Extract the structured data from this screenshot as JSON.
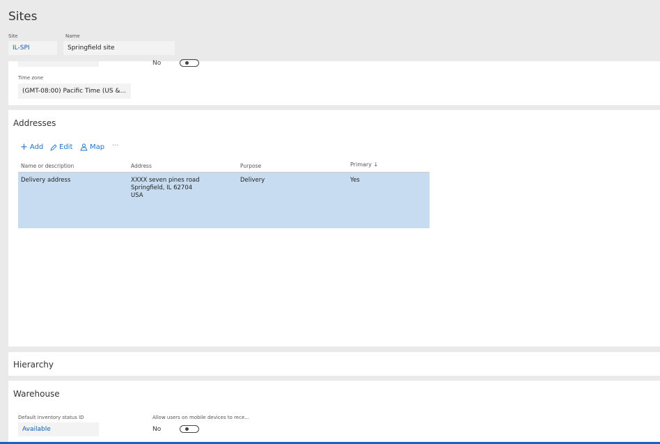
{
  "page": {
    "title": "Sites"
  },
  "header": {
    "site_label": "Site",
    "site_value": "IL-SPI",
    "name_label": "Name",
    "name_value": "Springfield site"
  },
  "general": {
    "partial_value": "No",
    "timezone_label": "Time zone",
    "timezone_value": "(GMT-08:00) Pacific Time (US &..."
  },
  "addresses": {
    "title": "Addresses",
    "toolbar": {
      "add": "Add",
      "edit": "Edit",
      "map": "Map",
      "more": "···"
    },
    "columns": [
      "Name or description",
      "Address",
      "Purpose",
      "Primary ↓"
    ],
    "rows": [
      {
        "name": "Delivery address",
        "address_line1": "XXXX seven pines road",
        "address_line2": "Springfield, IL 62704",
        "address_line3": "USA",
        "purpose": "Delivery",
        "primary": "Yes"
      }
    ]
  },
  "hierarchy": {
    "title": "Hierarchy"
  },
  "warehouse": {
    "title": "Warehouse",
    "status_label": "Default inventory status ID",
    "status_value": "Available",
    "mobile_label": "Allow users on mobile devices to rece...",
    "mobile_value": "No"
  },
  "colors": {
    "accent": "#0f5bb5",
    "selected_row": "#c7dcf0",
    "bottom_bar": "#1565c0"
  }
}
